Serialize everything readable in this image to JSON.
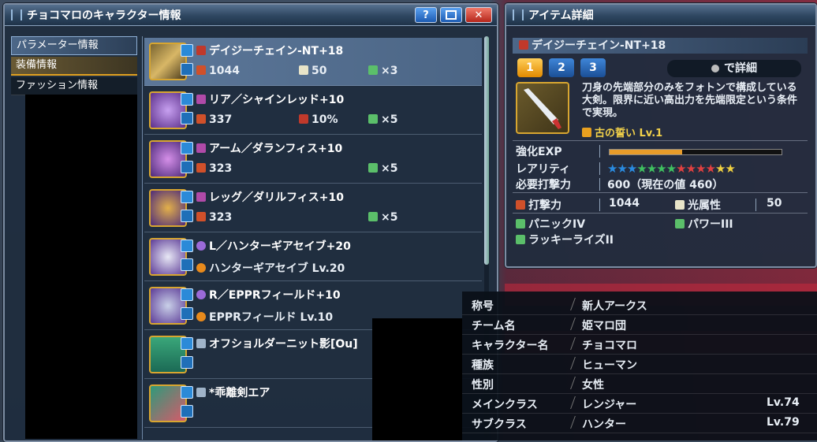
{
  "char_window": {
    "title": "チョコマロのキャラクター情報",
    "help_label": "?",
    "close_label": "✕",
    "sidebar": [
      {
        "label": "パラメーター情報"
      },
      {
        "label": "装備情報"
      },
      {
        "label": "ファッション情報"
      }
    ],
    "equipment": [
      {
        "name": "デイジーチェイン-NT+18",
        "stat1": "1044",
        "stat2": "50",
        "stat3": "×3",
        "color": "#c98b2a"
      },
      {
        "name": "リア／シャインレッド+10",
        "stat1": "337",
        "stat2": "10%",
        "stat3": "×5",
        "color": "#8a58b8"
      },
      {
        "name": "アーム／ダランフィス+10",
        "stat1": "323",
        "stat2": "",
        "stat3": "×5",
        "color": "#8a58b8"
      },
      {
        "name": "レッグ／ダリルフィス+10",
        "stat1": "323",
        "stat2": "",
        "stat3": "×5",
        "color": "#8a58b8"
      },
      {
        "name": "L／ハンターギアセイブ+20",
        "sub": "ハンターギアセイブ Lv.20",
        "color": "#8a58b8"
      },
      {
        "name": "R／EPPRフィールド+10",
        "sub": "EPPRフィールド Lv.10",
        "color": "#8a58b8"
      },
      {
        "name": "オフショルダーニット影[Ou]",
        "color": "#2fa07a"
      },
      {
        "name": "*乖離剣エア",
        "color": "#c96a7a"
      }
    ]
  },
  "item_window": {
    "title": "アイテム詳細",
    "item_name": "デイジーチェイン-NT+18",
    "tabs": [
      "1",
      "2",
      "3"
    ],
    "detail_button": "で詳細",
    "description": "刀身の先端部分のみをフォトンで構成している大剣。限界に近い高出力を先端限定という条件で実現。",
    "potential": "古の誓い Lv.1",
    "exp_label": "強化EXP",
    "exp_fill": 0.42,
    "rarity_label": "レアリティ",
    "rarity_stars": 13,
    "req_label": "必要打撃力",
    "req_value": "600（現在の値 460）",
    "atk_label": "打撃力",
    "atk_value": "1044",
    "element_label": "光属性",
    "element_value": "50",
    "affixes": [
      "パニックIV",
      "パワーIII",
      "ラッキーライズII"
    ]
  },
  "profile": {
    "rows": [
      {
        "key": "称号",
        "value": "新人アークス",
        "level": ""
      },
      {
        "key": "チーム名",
        "value": "姫マロ団",
        "level": ""
      },
      {
        "key": "キャラクター名",
        "value": "チョコマロ",
        "level": ""
      },
      {
        "key": "種族",
        "value": "ヒューマン",
        "level": ""
      },
      {
        "key": "性別",
        "value": "女性",
        "level": ""
      },
      {
        "key": "メインクラス",
        "value": "レンジャー",
        "level": "Lv.74"
      },
      {
        "key": "サブクラス",
        "value": "ハンター",
        "level": "Lv.79"
      }
    ]
  }
}
